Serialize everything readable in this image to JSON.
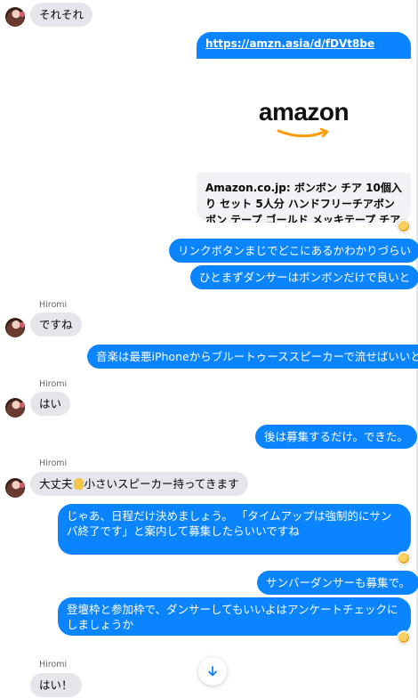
{
  "messages": {
    "m1": "それそれ",
    "link_url": "https://amzn.asia/d/fDVt8be",
    "link_logo": "amazon",
    "link_title": "Amazon.co.jp: ボンボン チア 10個入り セット 5人分 ハンドフリーチアボンボン テープ ゴールド メッキテープ チアガ…",
    "m2": "リンクボタンまじでどこにあるかわかりづらい",
    "m3": "ひとまずダンサーはボンボンだけで良いと",
    "sender1": "Hiromi",
    "m4": "ですね",
    "m5": "音楽は最悪iPhoneからブルートゥーススピーカーで流せばいいと",
    "sender2": "Hiromi",
    "m6": "はい",
    "m7": "後は募集するだけ。できた。",
    "sender3": "Hiromi",
    "m8_prefix": "大丈夫",
    "m8_suffix": "小さいスピーカー持ってきます",
    "m9": "じゃあ、日程だけ決めましょう。 「タイムアップは強制的にサンバ終了です」と案内して募集したらいいですね",
    "m10": "サンバーダンサーも募集で。",
    "m11": "登壇枠と参加枠で、ダンサーしてもいいよはアンケートチェックにしましょうか",
    "sender4": "Hiromi",
    "m12": "はい！"
  },
  "colors": {
    "outgoing_bubble": "#0b84ff",
    "incoming_bubble": "#e4e6eb",
    "sender_text": "#65676b"
  },
  "icons": {
    "scroll_down": "arrow-down-icon",
    "read_receipt": "avatar-read-receipt-icon",
    "hand_emoji": "ok-hand-emoji-icon"
  }
}
